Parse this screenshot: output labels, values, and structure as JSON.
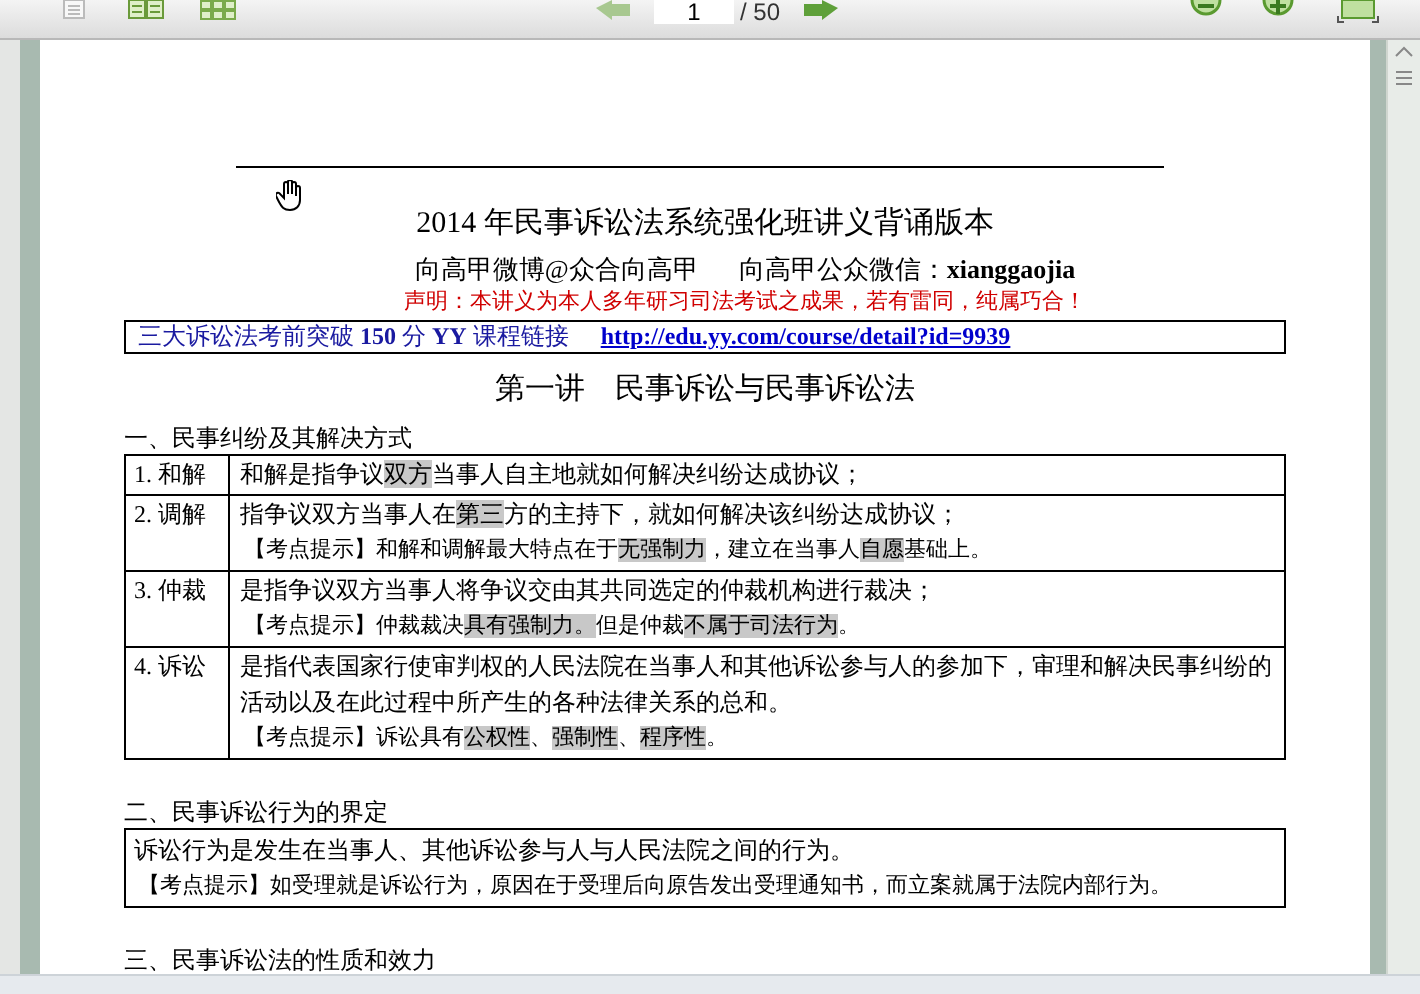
{
  "toolbar": {
    "page_field": {
      "value": "1"
    },
    "page_total": "/ 50"
  },
  "document": {
    "title": "2014 年民事诉讼法系统强化班讲义背诵版本",
    "author_line": [
      "向高甲微博@众合向高甲",
      "向高甲公众微信：**xianggaojia**"
    ],
    "notice": "声明：本讲义为本人多年研习司法考试之成果，若有雷同，纯属巧合！",
    "course_box": {
      "text": "三大诉讼法考前突破 **150** 分 **YY** 课程链接",
      "link": "http://edu.yy.com/course/detail?id=9939"
    },
    "lecture_heading": "第一讲　民事诉讼与民事诉讼法",
    "sections": [
      {
        "heading": "一、民事纠纷及其解决方式",
        "kind": "table",
        "rows": [
          {
            "label": "1. 和解",
            "lines": [
              {
                "kind": "definition",
                "segments": [
                  {
                    "text": "和解是指争议",
                    "highlighted": false
                  },
                  {
                    "text": "双方",
                    "highlighted": true
                  },
                  {
                    "text": "当事人自主地就如何解决纠纷达成协议；",
                    "highlighted": false
                  }
                ]
              }
            ]
          },
          {
            "label": "2. 调解",
            "lines": [
              {
                "kind": "definition",
                "segments": [
                  {
                    "text": "指争议双方当事人在",
                    "highlighted": false
                  },
                  {
                    "text": "第三",
                    "highlighted": true
                  },
                  {
                    "text": "方的主持下，就如何解决该纠纷达成协议；",
                    "highlighted": false
                  }
                ]
              },
              {
                "kind": "tip",
                "segments": [
                  {
                    "text": "【考点提示】和解和调解最大特点在于",
                    "highlighted": false
                  },
                  {
                    "text": "无强制力",
                    "highlighted": true
                  },
                  {
                    "text": "，建立在当事人",
                    "highlighted": false
                  },
                  {
                    "text": "自愿",
                    "highlighted": true
                  },
                  {
                    "text": "基础上。",
                    "highlighted": false
                  }
                ]
              }
            ]
          },
          {
            "label": "3. 仲裁",
            "lines": [
              {
                "kind": "definition",
                "segments": [
                  {
                    "text": "是指争议双方当事人将争议交由其共同选定的仲裁机构进行裁决；",
                    "highlighted": false
                  }
                ]
              },
              {
                "kind": "tip",
                "segments": [
                  {
                    "text": "【考点提示】仲裁裁决",
                    "highlighted": false
                  },
                  {
                    "text": "具有强制力。",
                    "highlighted": true
                  },
                  {
                    "text": "但是仲裁",
                    "highlighted": false
                  },
                  {
                    "text": "不属于司法行为",
                    "highlighted": true
                  },
                  {
                    "text": "。",
                    "highlighted": false
                  }
                ]
              }
            ]
          },
          {
            "label": "4. 诉讼",
            "lines": [
              {
                "kind": "definition",
                "segments": [
                  {
                    "text": "是指代表国家行使审判权的人民法院在当事人和其他诉讼参与人的参加下，审理和解决民事纠纷的活动以及在此过程中所产生的各种法律关系的总和。",
                    "highlighted": false
                  }
                ]
              },
              {
                "kind": "tip",
                "segments": [
                  {
                    "text": "【考点提示】诉讼具有",
                    "highlighted": false
                  },
                  {
                    "text": "公权性",
                    "highlighted": true
                  },
                  {
                    "text": "、",
                    "highlighted": false
                  },
                  {
                    "text": "强制性",
                    "highlighted": true
                  },
                  {
                    "text": "、",
                    "highlighted": false
                  },
                  {
                    "text": "程序性",
                    "highlighted": true
                  },
                  {
                    "text": "。",
                    "highlighted": false
                  }
                ]
              }
            ]
          }
        ]
      },
      {
        "heading": "二、民事诉讼行为的界定",
        "kind": "box",
        "lines": [
          {
            "kind": "definition",
            "segments": [
              {
                "text": "诉讼行为是发生在当事人、其他诉讼参与人与人民法院之间的行为。",
                "highlighted": false
              }
            ]
          },
          {
            "kind": "tip",
            "segments": [
              {
                "text": "【考点提示】如受理就是诉讼行为，原因在于受理后向原告发出受理通知书，而立案就属于法院内部行为。",
                "highlighted": false
              }
            ]
          }
        ]
      },
      {
        "heading": "三、民事诉讼法的性质和效力",
        "kind": "heading_only"
      }
    ]
  }
}
